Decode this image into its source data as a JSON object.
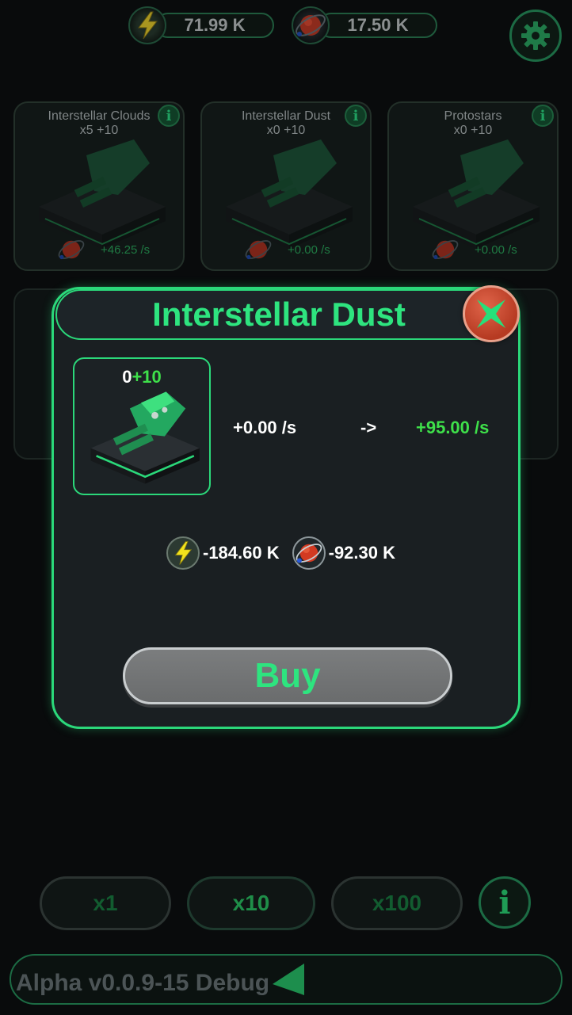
{
  "resources": {
    "energy": {
      "value": "71.99 K",
      "icon": "lightning-bolt-icon"
    },
    "matter": {
      "value": "17.50 K",
      "icon": "planet-icon"
    }
  },
  "settings_icon": "gear-icon",
  "cards": [
    {
      "title": "Interstellar Clouds",
      "count": "x5 +10",
      "rate": "+46.25 /s"
    },
    {
      "title": "Interstellar Dust",
      "count": "x0 +10",
      "rate": "+0.00 /s"
    },
    {
      "title": "Protostars",
      "count": "x0 +10",
      "rate": "+0.00 /s"
    }
  ],
  "modal": {
    "title": "Interstellar Dust",
    "owned": "0",
    "add": "+10",
    "current_rate": "+0.00 /s",
    "arrow": "->",
    "new_rate": "+95.00 /s",
    "cost_energy": "-184.60 K",
    "cost_matter": "-92.30 K",
    "buy_label": "Buy"
  },
  "multipliers": [
    "x1",
    "x10",
    "x100"
  ],
  "selected_multiplier": "x10",
  "info_label": "i",
  "version": "Alpha v0.0.9-15 Debug",
  "colors": {
    "accent": "#2ee47f",
    "gain": "#3ee04a",
    "close": "#c8442a"
  }
}
